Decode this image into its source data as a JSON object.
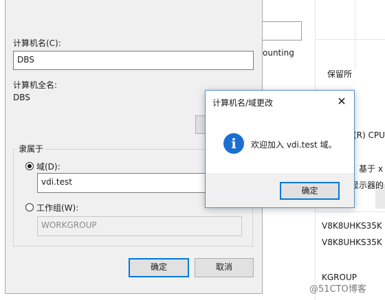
{
  "background_window": {
    "texts": [
      {
        "key": "accounting",
        "value": "ounting"
      },
      {
        "key": "reserved",
        "value": "保留所"
      },
      {
        "key": "cpu",
        "value": "(R) CPU"
      },
      {
        "key": "based_on",
        "value": "，基于 x"
      },
      {
        "key": "display",
        "value": "显示器的"
      },
      {
        "key": "product_id_1",
        "value": "V8K8UHKS35K"
      },
      {
        "key": "product_id_2",
        "value": "V8K8UHKS35K"
      },
      {
        "key": "workgroup",
        "value": "KGROUP"
      }
    ]
  },
  "dialog": {
    "computer_name_label": "计算机名(C):",
    "computer_name_value": "DBS",
    "full_name_label": "计算机全名:",
    "full_name_value": "DBS",
    "member_of_label": "隶属于",
    "domain_label": "域(D):",
    "domain_value": "vdi.test",
    "workgroup_label": "工作组(W):",
    "workgroup_value": "WORKGROUP",
    "ok_label": "确定",
    "cancel_label": "取消"
  },
  "message_box": {
    "title": "计算机名/域更改",
    "close_glyph": "✕",
    "icon_glyph": "i",
    "message": "欢迎加入 vdi.test 域。",
    "ok_label": "确定"
  },
  "watermark": "@51CTO博客",
  "colors": {
    "accent": "#0078d7",
    "info_icon": "#1c6fd1",
    "dialog_bg": "#f0f0f0"
  }
}
